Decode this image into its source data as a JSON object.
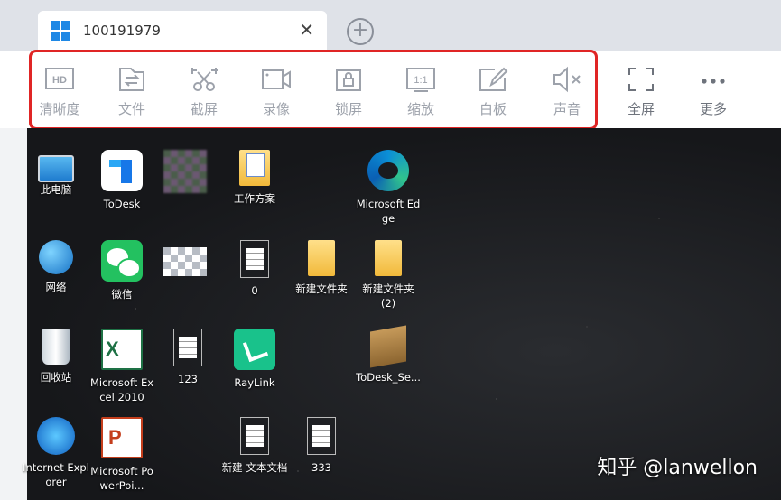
{
  "tab": {
    "title": "100191979",
    "close": "✕",
    "new_tab": "+"
  },
  "toolbar": {
    "items": [
      {
        "label": "清晰度",
        "icon": "hd-icon",
        "glyph": "HD"
      },
      {
        "label": "文件",
        "icon": "file-transfer-icon"
      },
      {
        "label": "截屏",
        "icon": "screenshot-icon"
      },
      {
        "label": "录像",
        "icon": "video-record-icon"
      },
      {
        "label": "锁屏",
        "icon": "lock-icon"
      },
      {
        "label": "缩放",
        "icon": "scale-icon",
        "glyph": "1:1"
      },
      {
        "label": "白板",
        "icon": "whiteboard-icon"
      },
      {
        "label": "声音",
        "icon": "sound-muted-icon"
      },
      {
        "label": "全屏",
        "icon": "fullscreen-icon"
      },
      {
        "label": "更多",
        "icon": "more-icon",
        "glyph": "•••"
      }
    ]
  },
  "desktop": {
    "icons": [
      {
        "label": "此电脑"
      },
      {
        "label": "ToDesk"
      },
      {
        "label": ""
      },
      {
        "label": "工作方案"
      },
      {
        "label": "Microsoft Edge"
      },
      {
        "label": "网络"
      },
      {
        "label": "微信"
      },
      {
        "label": ""
      },
      {
        "label": "0"
      },
      {
        "label": "新建文件夹"
      },
      {
        "label": "新建文件夹 (2)"
      },
      {
        "label": "回收站"
      },
      {
        "label": "Microsoft Excel 2010"
      },
      {
        "label": "123"
      },
      {
        "label": "RayLink"
      },
      {
        "label": "ToDesk_Se..."
      },
      {
        "label": "Internet Explorer"
      },
      {
        "label": "Microsoft PowerPoi..."
      },
      {
        "label": "新建 文本文档"
      },
      {
        "label": "333"
      }
    ]
  },
  "watermark": "知乎 @lanwellon",
  "colors": {
    "highlight": "#e02525",
    "tab_bar": "#dfe2e8",
    "icon_gray": "#9da2ab"
  }
}
